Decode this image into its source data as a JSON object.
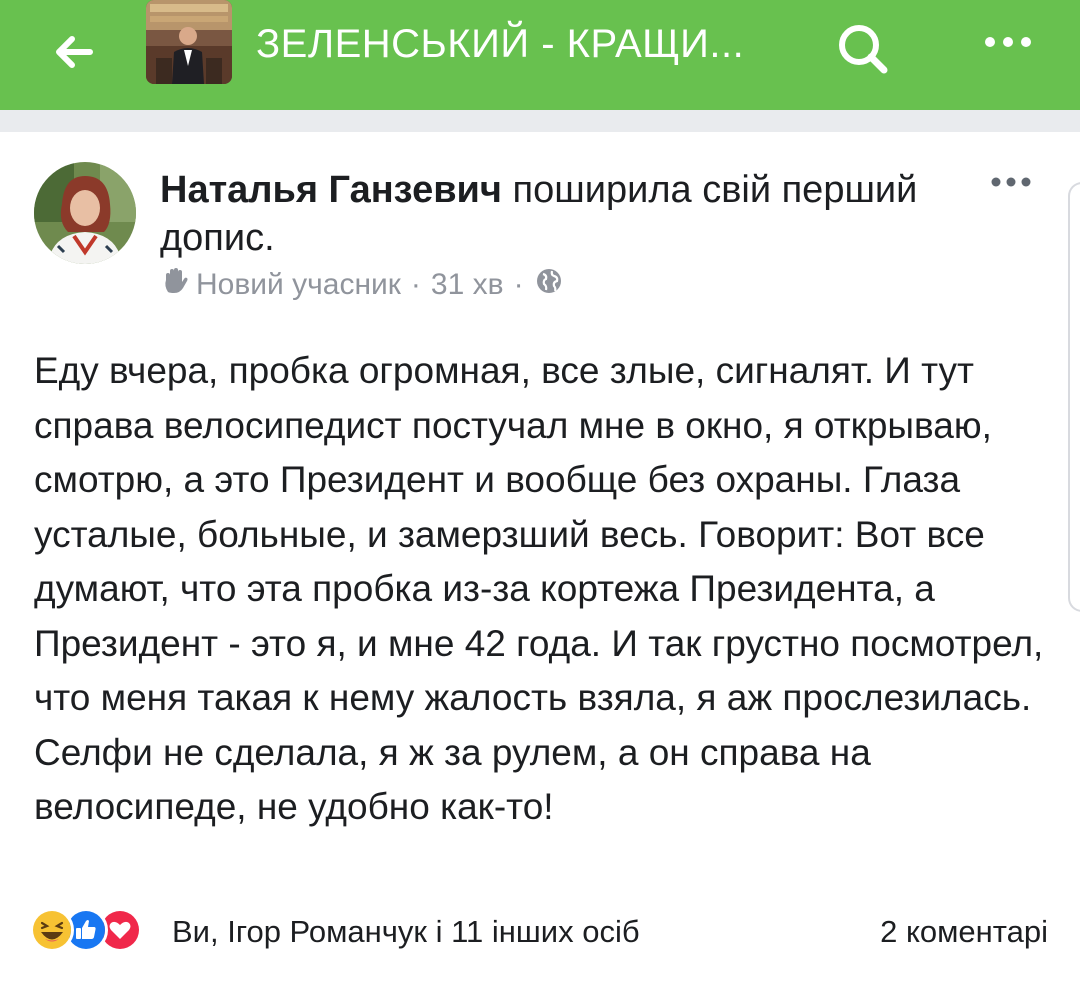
{
  "header": {
    "group_title": "ЗЕЛЕНСЬКИЙ - КРАЩИ...",
    "accent_color": "#68c14f",
    "icons": [
      "back-arrow-icon",
      "search-icon",
      "more-icon"
    ]
  },
  "post": {
    "author": "Наталья Ганзевич",
    "action": " поширила свій перший допис.",
    "badge": "Новий учасник",
    "time": "31 хв",
    "privacy_icon": "globe-icon",
    "body": "Еду вчера, пробка огромная, все злые, сигналят. И тут справа велосипедист постучал мне в окно, я открываю, смотрю, а это Президент и вообще без охраны. Глаза усталые, больные, и замерзший весь. Говорит: Вот все думают, что эта пробка из-за кортежа Президента, а Президент - это я, и мне 42 года. И так грустно посмотрел, что меня такая к нему жалость взяла, я аж прослезилась. Селфи не сделала, я ж за рулем, а он справа на велосипеде, не удобно как-то!",
    "reactions_text": "Ви, Ігор Романчук і 11 інших осіб",
    "comments": "2 коментарі",
    "reaction_icons": [
      "haha-icon",
      "like-icon",
      "love-icon"
    ]
  }
}
